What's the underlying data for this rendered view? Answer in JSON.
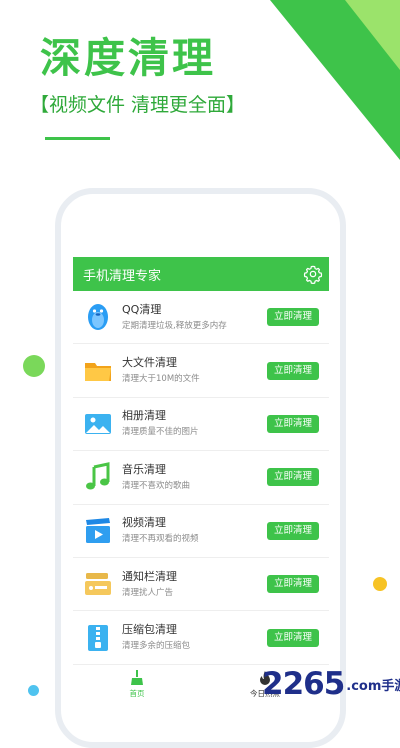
{
  "promo": {
    "headline": "深度清理",
    "subline": "【视频文件 清理更全面】"
  },
  "app": {
    "title": "手机清理专家",
    "settings_icon": "gear-icon"
  },
  "items": [
    {
      "title": "QQ清理",
      "desc": "定期清理垃圾,释放更多内存",
      "button": "立即清理",
      "icon": "qq-penguin-icon"
    },
    {
      "title": "大文件清理",
      "desc": "清理大于10M的文件",
      "button": "立即清理",
      "icon": "folder-icon"
    },
    {
      "title": "相册清理",
      "desc": "清理质量不佳的图片",
      "button": "立即清理",
      "icon": "photo-icon"
    },
    {
      "title": "音乐清理",
      "desc": "清理不喜欢的歌曲",
      "button": "立即清理",
      "icon": "music-note-icon"
    },
    {
      "title": "视频清理",
      "desc": "清理不再观看的视频",
      "button": "立即清理",
      "icon": "video-icon"
    },
    {
      "title": "通知栏清理",
      "desc": "清理扰人广告",
      "button": "立即清理",
      "icon": "notification-icon"
    },
    {
      "title": "压缩包清理",
      "desc": "清理多余的压缩包",
      "button": "立即清理",
      "icon": "zip-archive-icon"
    }
  ],
  "bottom_nav": [
    {
      "label": "首页",
      "icon": "broom-icon",
      "active": true
    },
    {
      "label": "今日热点",
      "icon": "flame-icon",
      "active": false
    }
  ],
  "watermark": {
    "logo": "2265",
    "text": ".com手游网"
  },
  "colors": {
    "accent": "#3ec34a",
    "accent_light": "#9be36b",
    "dot_green": "#7ad85a",
    "dot_yellow": "#f7c325",
    "dot_blue": "#4fc3ef",
    "watermark": "#1f2f8a"
  }
}
